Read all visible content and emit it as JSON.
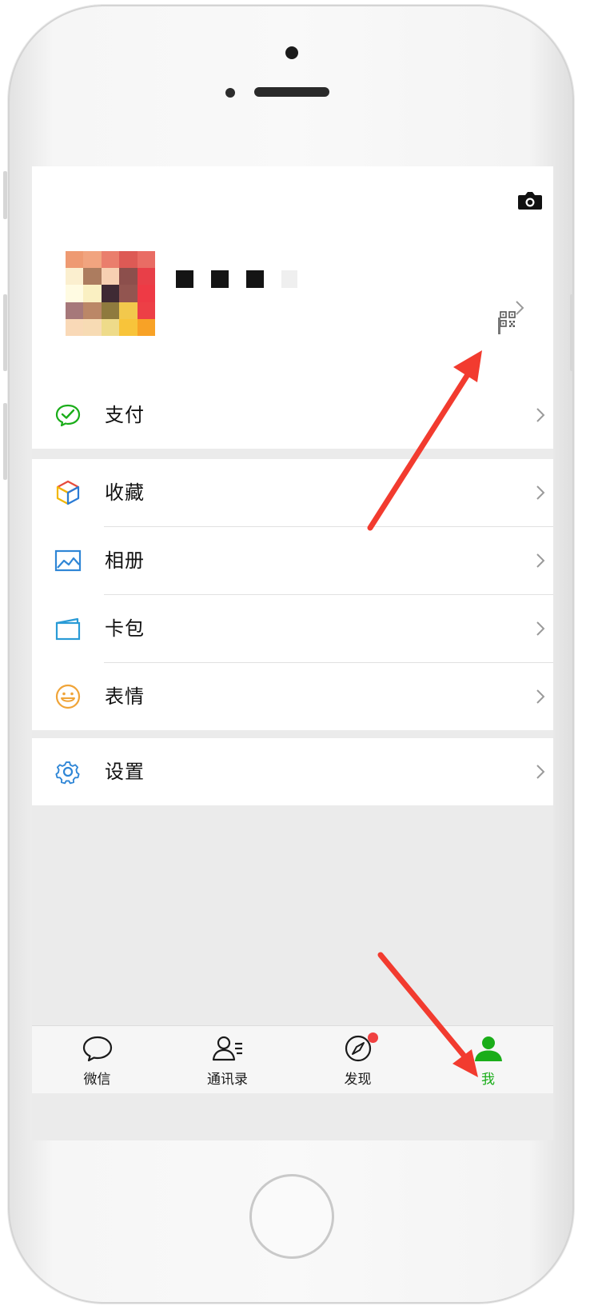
{
  "profile": {
    "nickname": "■■■"
  },
  "menu": {
    "group1": [
      {
        "label": "支付",
        "icon": "payment-icon"
      }
    ],
    "group2": [
      {
        "label": "收藏",
        "icon": "favorites-icon"
      },
      {
        "label": "相册",
        "icon": "album-icon"
      },
      {
        "label": "卡包",
        "icon": "card-wallet-icon"
      },
      {
        "label": "表情",
        "icon": "sticker-icon"
      }
    ],
    "group3": [
      {
        "label": "设置",
        "icon": "gear-icon"
      }
    ]
  },
  "tabbar": {
    "tabs": [
      {
        "label": "微信",
        "icon": "chat-bubble-icon",
        "active": false
      },
      {
        "label": "通讯录",
        "icon": "contacts-icon",
        "active": false
      },
      {
        "label": "发现",
        "icon": "compass-icon",
        "active": false,
        "badge": true
      },
      {
        "label": "我",
        "icon": "person-icon",
        "active": true
      }
    ]
  },
  "colors": {
    "accent_green": "#1aad19",
    "badge_red": "#f04141",
    "annotation_arrow": "#f23b2f"
  }
}
